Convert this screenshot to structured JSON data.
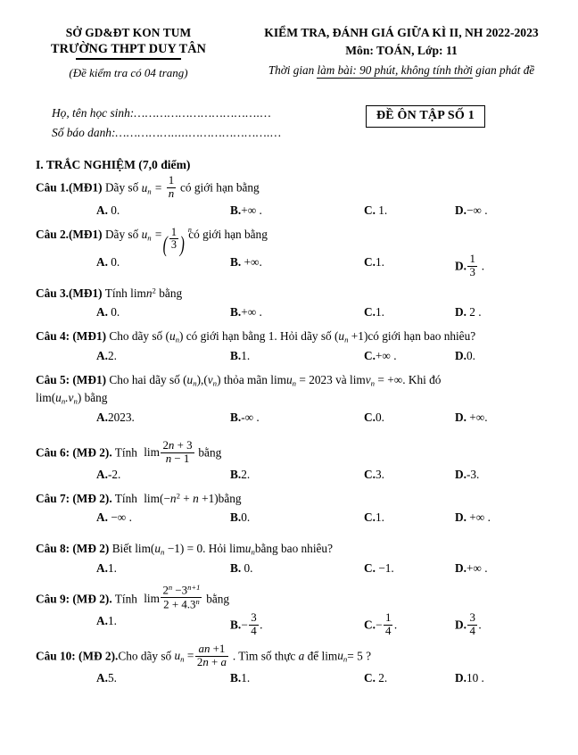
{
  "header": {
    "department": "SỞ GD&ĐT KON TUM",
    "school": "TRƯỜNG THPT DUY TÂN",
    "pages_note": "(Đề kiểm tra có 04 trang)",
    "exam_title": "KIỂM TRA, ĐÁNH GIÁ GIỮA KÌ II, NH 2022-2023",
    "subject_line": "Môn: TOÁN,  Lớp: 11",
    "time_prefix": "Thời gian ",
    "time_underlined": "làm bài: 90 phút, không tính thời",
    "time_suffix": " gian phát đề"
  },
  "student_info": {
    "name_label": "Họ, tên học sinh:",
    "name_dots": "…………………………….…",
    "id_label": "Số báo danh:",
    "id_dots": "…………….....………………….…",
    "exam_code": "ĐỀ ÔN TẬP SỐ 1"
  },
  "section": {
    "title": "I. TRẮC NGHIỆM (7,0 điểm)"
  },
  "questions": [
    {
      "label": "Câu 1.(MĐ1)",
      "text_before": "Dãy số",
      "text_after": "có giới hạn bằng",
      "options": [
        {
          "letter": "A.",
          "value": "0."
        },
        {
          "letter": "B.",
          "value": "+∞ ."
        },
        {
          "letter": "C.",
          "value": "1."
        },
        {
          "letter": "D.",
          "value": "−∞ ."
        }
      ]
    },
    {
      "label": "Câu 2.(MĐ1)",
      "text_before": "Dãy số",
      "text_after": "có giới hạn bằng",
      "options": [
        {
          "letter": "A.",
          "value": "0."
        },
        {
          "letter": "B.",
          "value": "+∞."
        },
        {
          "letter": "C.",
          "value": "1."
        },
        {
          "letter": "D.",
          "value": "1/3 ."
        }
      ]
    },
    {
      "label": "Câu 3.(MĐ1)",
      "text_before": "Tính",
      "text_after": "bằng",
      "options": [
        {
          "letter": "A.",
          "value": "0."
        },
        {
          "letter": "B.",
          "value": "+∞ ."
        },
        {
          "letter": "C.",
          "value": "1."
        },
        {
          "letter": "D.",
          "value": "2 ."
        }
      ]
    },
    {
      "label": "Câu 4: (MĐ1)",
      "text_before": "Cho dãy số",
      "text_mid": "có giới hạn bằng 1. Hỏi dãy số",
      "text_after": "có giới hạn bao nhiêu?",
      "options": [
        {
          "letter": "A.",
          "value": "2."
        },
        {
          "letter": "B.",
          "value": "1."
        },
        {
          "letter": "C.",
          "value": "+∞ ."
        },
        {
          "letter": "D.",
          "value": "0."
        }
      ]
    },
    {
      "label": "Câu 5: (MĐ1)",
      "text_before": "Cho hai dãy số",
      "text_mid": "thỏa mãn",
      "text_eq1": "= 2023",
      "text_and": "và",
      "text_eq2": "= +∞",
      "text_after": ". Khi đó",
      "line2_after": "bằng",
      "options": [
        {
          "letter": "A.",
          "value": "2023."
        },
        {
          "letter": "B.",
          "value": "-∞ ."
        },
        {
          "letter": "C.",
          "value": "0."
        },
        {
          "letter": "D.",
          "value": "+∞."
        }
      ]
    },
    {
      "label": "Câu 6: (MĐ 2).",
      "text_before": "Tính",
      "text_after": "bằng",
      "options": [
        {
          "letter": "A.",
          "value": "-2."
        },
        {
          "letter": "B.",
          "value": "2."
        },
        {
          "letter": "C.",
          "value": "3."
        },
        {
          "letter": "D.",
          "value": "-3."
        }
      ]
    },
    {
      "label": "Câu 7: (MĐ 2).",
      "text_before": "Tính",
      "text_after": "bằng",
      "options": [
        {
          "letter": "A.",
          "value": "−∞ ."
        },
        {
          "letter": "B.",
          "value": "0."
        },
        {
          "letter": "C.",
          "value": "1."
        },
        {
          "letter": "D.",
          "value": "+∞ ."
        }
      ]
    },
    {
      "label": "Câu 8: (MĐ 2)",
      "text_before": "Biết",
      "text_mid": "= 0",
      "text_after": ". Hỏi",
      "text_end": "bằng  bao nhiêu?",
      "options": [
        {
          "letter": "A.",
          "value": "1."
        },
        {
          "letter": "B.",
          "value": "0."
        },
        {
          "letter": "C.",
          "value": "−1."
        },
        {
          "letter": "D.",
          "value": "+∞ ."
        }
      ]
    },
    {
      "label": "Câu 9: (MĐ 2).",
      "text_before": "Tính",
      "text_after": "bằng",
      "options": [
        {
          "letter": "A.",
          "value": "1."
        },
        {
          "letter": "B.",
          "value": "−3/4 ."
        },
        {
          "letter": "C.",
          "value": "−1/4 ."
        },
        {
          "letter": "D.",
          "value": "3/4 ."
        }
      ]
    },
    {
      "label": "Câu 10: (MĐ 2).",
      "text_before": "Cho dãy số",
      "text_mid": ". Tìm số thực",
      "text_var": "a",
      "text_after": "để",
      "text_end": "= 5 ?",
      "options": [
        {
          "letter": "A.",
          "value": "5."
        },
        {
          "letter": "B.",
          "value": "1."
        },
        {
          "letter": "C.",
          "value": "2."
        },
        {
          "letter": "D.",
          "value": "10 ."
        }
      ]
    }
  ],
  "math": {
    "lim": "lim",
    "u_sub": "u",
    "v_sub": "v",
    "n": "n"
  }
}
